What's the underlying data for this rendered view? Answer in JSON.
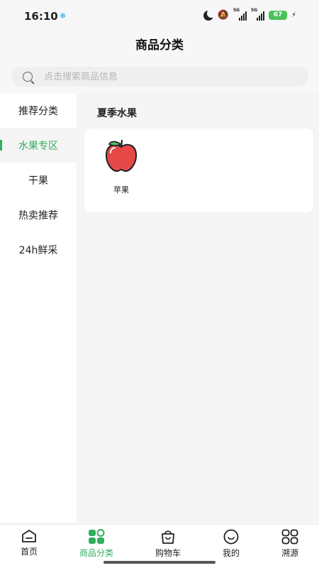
{
  "status_bar": {
    "time": "16:10",
    "signal_labels": [
      "5G",
      "5G"
    ],
    "battery": "67"
  },
  "header": {
    "title": "商品分类"
  },
  "search": {
    "placeholder": "点击搜索商品信息"
  },
  "sidebar": {
    "items": [
      {
        "label": "推荐分类",
        "active": false
      },
      {
        "label": "水果专区",
        "active": true
      },
      {
        "label": "干果",
        "active": false
      },
      {
        "label": "热卖推荐",
        "active": false
      },
      {
        "label": "24h鲜采",
        "active": false
      }
    ]
  },
  "content": {
    "section_title": "夏季水果",
    "products": [
      {
        "name": "苹果",
        "icon": "apple-icon"
      }
    ]
  },
  "tabbar": {
    "tabs": [
      {
        "label": "首页",
        "icon": "home-icon"
      },
      {
        "label": "商品分类",
        "icon": "category-icon",
        "active": true
      },
      {
        "label": "购物车",
        "icon": "cart-icon"
      },
      {
        "label": "我的",
        "icon": "profile-icon"
      },
      {
        "label": "溯源",
        "icon": "trace-icon"
      }
    ]
  },
  "colors": {
    "accent": "#2fae5b",
    "background": "#f5f5f5"
  }
}
